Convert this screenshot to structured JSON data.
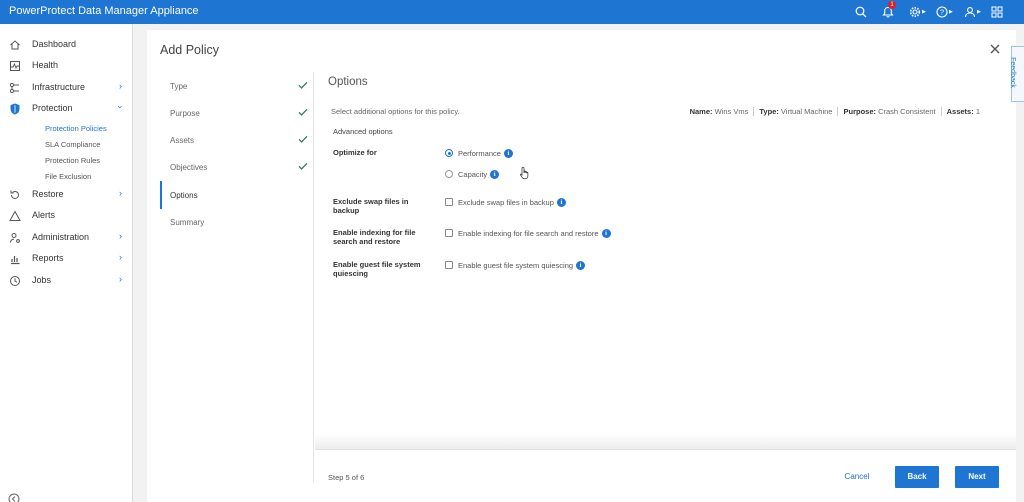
{
  "app": {
    "title": "PowerProtect Data Manager Appliance",
    "notification_count": "1"
  },
  "sidebar": {
    "items": [
      {
        "label": "Dashboard",
        "icon": "home-icon",
        "has_children": false
      },
      {
        "label": "Health",
        "icon": "health-icon",
        "has_children": false
      },
      {
        "label": "Infrastructure",
        "icon": "infrastructure-icon",
        "has_children": true
      },
      {
        "label": "Protection",
        "icon": "shield-icon",
        "has_children": true,
        "expanded": true
      },
      {
        "label": "Restore",
        "icon": "restore-icon",
        "has_children": true
      },
      {
        "label": "Alerts",
        "icon": "alert-icon",
        "has_children": false
      },
      {
        "label": "Administration",
        "icon": "administration-icon",
        "has_children": true
      },
      {
        "label": "Reports",
        "icon": "reports-icon",
        "has_children": true
      },
      {
        "label": "Jobs",
        "icon": "jobs-icon",
        "has_children": true
      }
    ],
    "protection_sub": [
      "Protection Policies",
      "SLA Compliance",
      "Protection Rules",
      "File Exclusion"
    ],
    "active_sub": "Protection Policies"
  },
  "dialog": {
    "title": "Add Policy",
    "steps": [
      {
        "label": "Type",
        "done": true
      },
      {
        "label": "Purpose",
        "done": true
      },
      {
        "label": "Assets",
        "done": true
      },
      {
        "label": "Objectives",
        "done": true
      },
      {
        "label": "Options",
        "done": false,
        "active": true
      },
      {
        "label": "Summary",
        "done": false
      }
    ],
    "content": {
      "title": "Options",
      "subtitle": "Select additional options for this policy.",
      "meta": {
        "name_label": "Name:",
        "name": "Wins Vms",
        "type_label": "Type:",
        "type": "Virtual Machine",
        "purpose_label": "Purpose:",
        "purpose": "Crash Consistent",
        "assets_label": "Assets:",
        "assets": "1"
      },
      "advanced_label": "Advanced options",
      "optimize_label": "Optimize for",
      "optimize_options": [
        {
          "label": "Performance",
          "selected": true
        },
        {
          "label": "Capacity",
          "selected": false
        }
      ],
      "swap_label": "Exclude swap files in backup",
      "swap_option": "Exclude swap files in backup",
      "indexing_label": "Enable indexing for file search and restore",
      "indexing_option": "Enable indexing for file search and restore",
      "quiesce_label": "Enable guest file system quiescing",
      "quiesce_option": "Enable guest file system quiescing"
    },
    "footer": {
      "step_text": "Step 5 of 6",
      "cancel": "Cancel",
      "back": "Back",
      "next": "Next"
    }
  },
  "feedback_label": "Feedback",
  "colors": {
    "brand": "#1e75d2",
    "check": "#2e7d5b"
  }
}
